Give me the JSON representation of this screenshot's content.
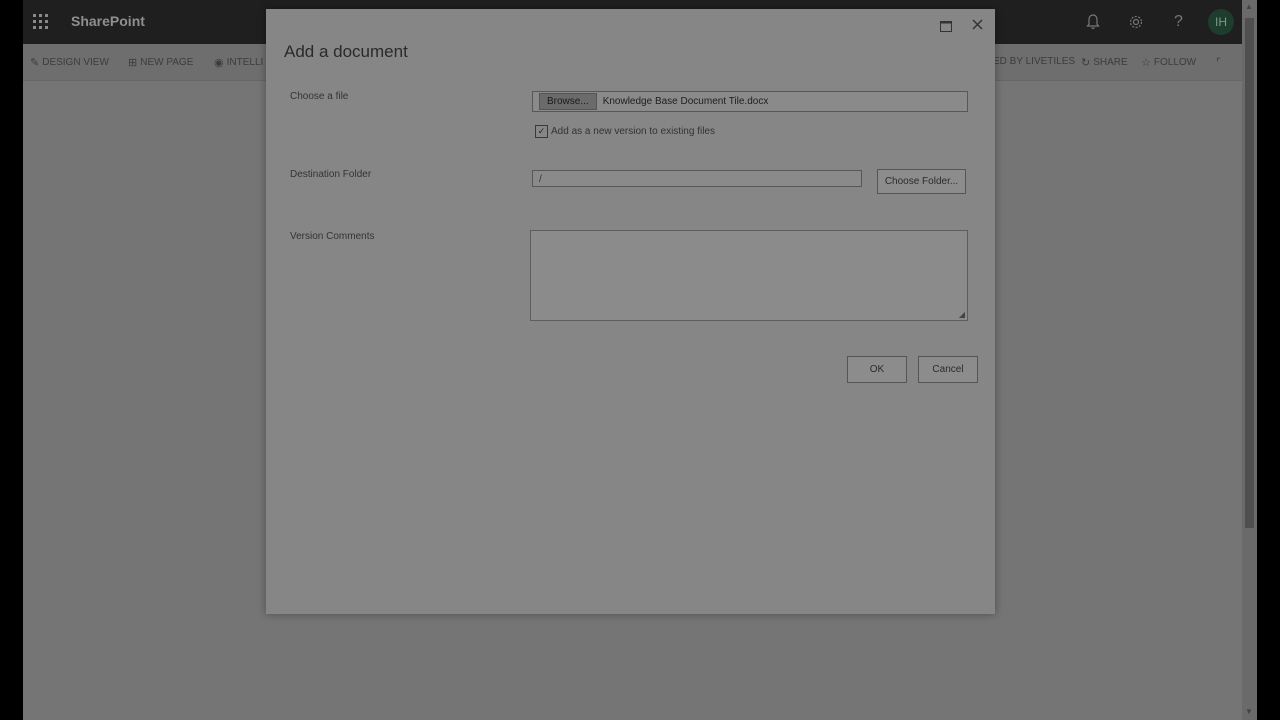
{
  "suitebar": {
    "brand": "SharePoint",
    "avatar_initials": "IH",
    "help_glyph": "?"
  },
  "commandbar": {
    "design_view": "DESIGN VIEW",
    "new_page": "NEW PAGE",
    "intelli": "INTELLI",
    "livetiles": "ED BY LIVETILES",
    "share": "SHARE",
    "follow": "FOLLOW"
  },
  "dialog": {
    "title": "Add a document",
    "choose_file_label": "Choose a file",
    "browse_label": "Browse...",
    "file_name": "Knowledge Base Document Tile.docx",
    "add_version_label": "Add as a new version to existing files",
    "add_version_checked": true,
    "destination_label": "Destination Folder",
    "destination_value": "/",
    "choose_folder_label": "Choose Folder...",
    "comments_label": "Version Comments",
    "ok_label": "OK",
    "cancel_label": "Cancel"
  },
  "icons": [
    "app-launcher-icon",
    "bell-icon",
    "gear-icon",
    "help-icon",
    "pencil-icon",
    "plus-box-icon",
    "livetiles-icon",
    "share-icon",
    "star-icon",
    "maximize-icon",
    "close-icon"
  ]
}
